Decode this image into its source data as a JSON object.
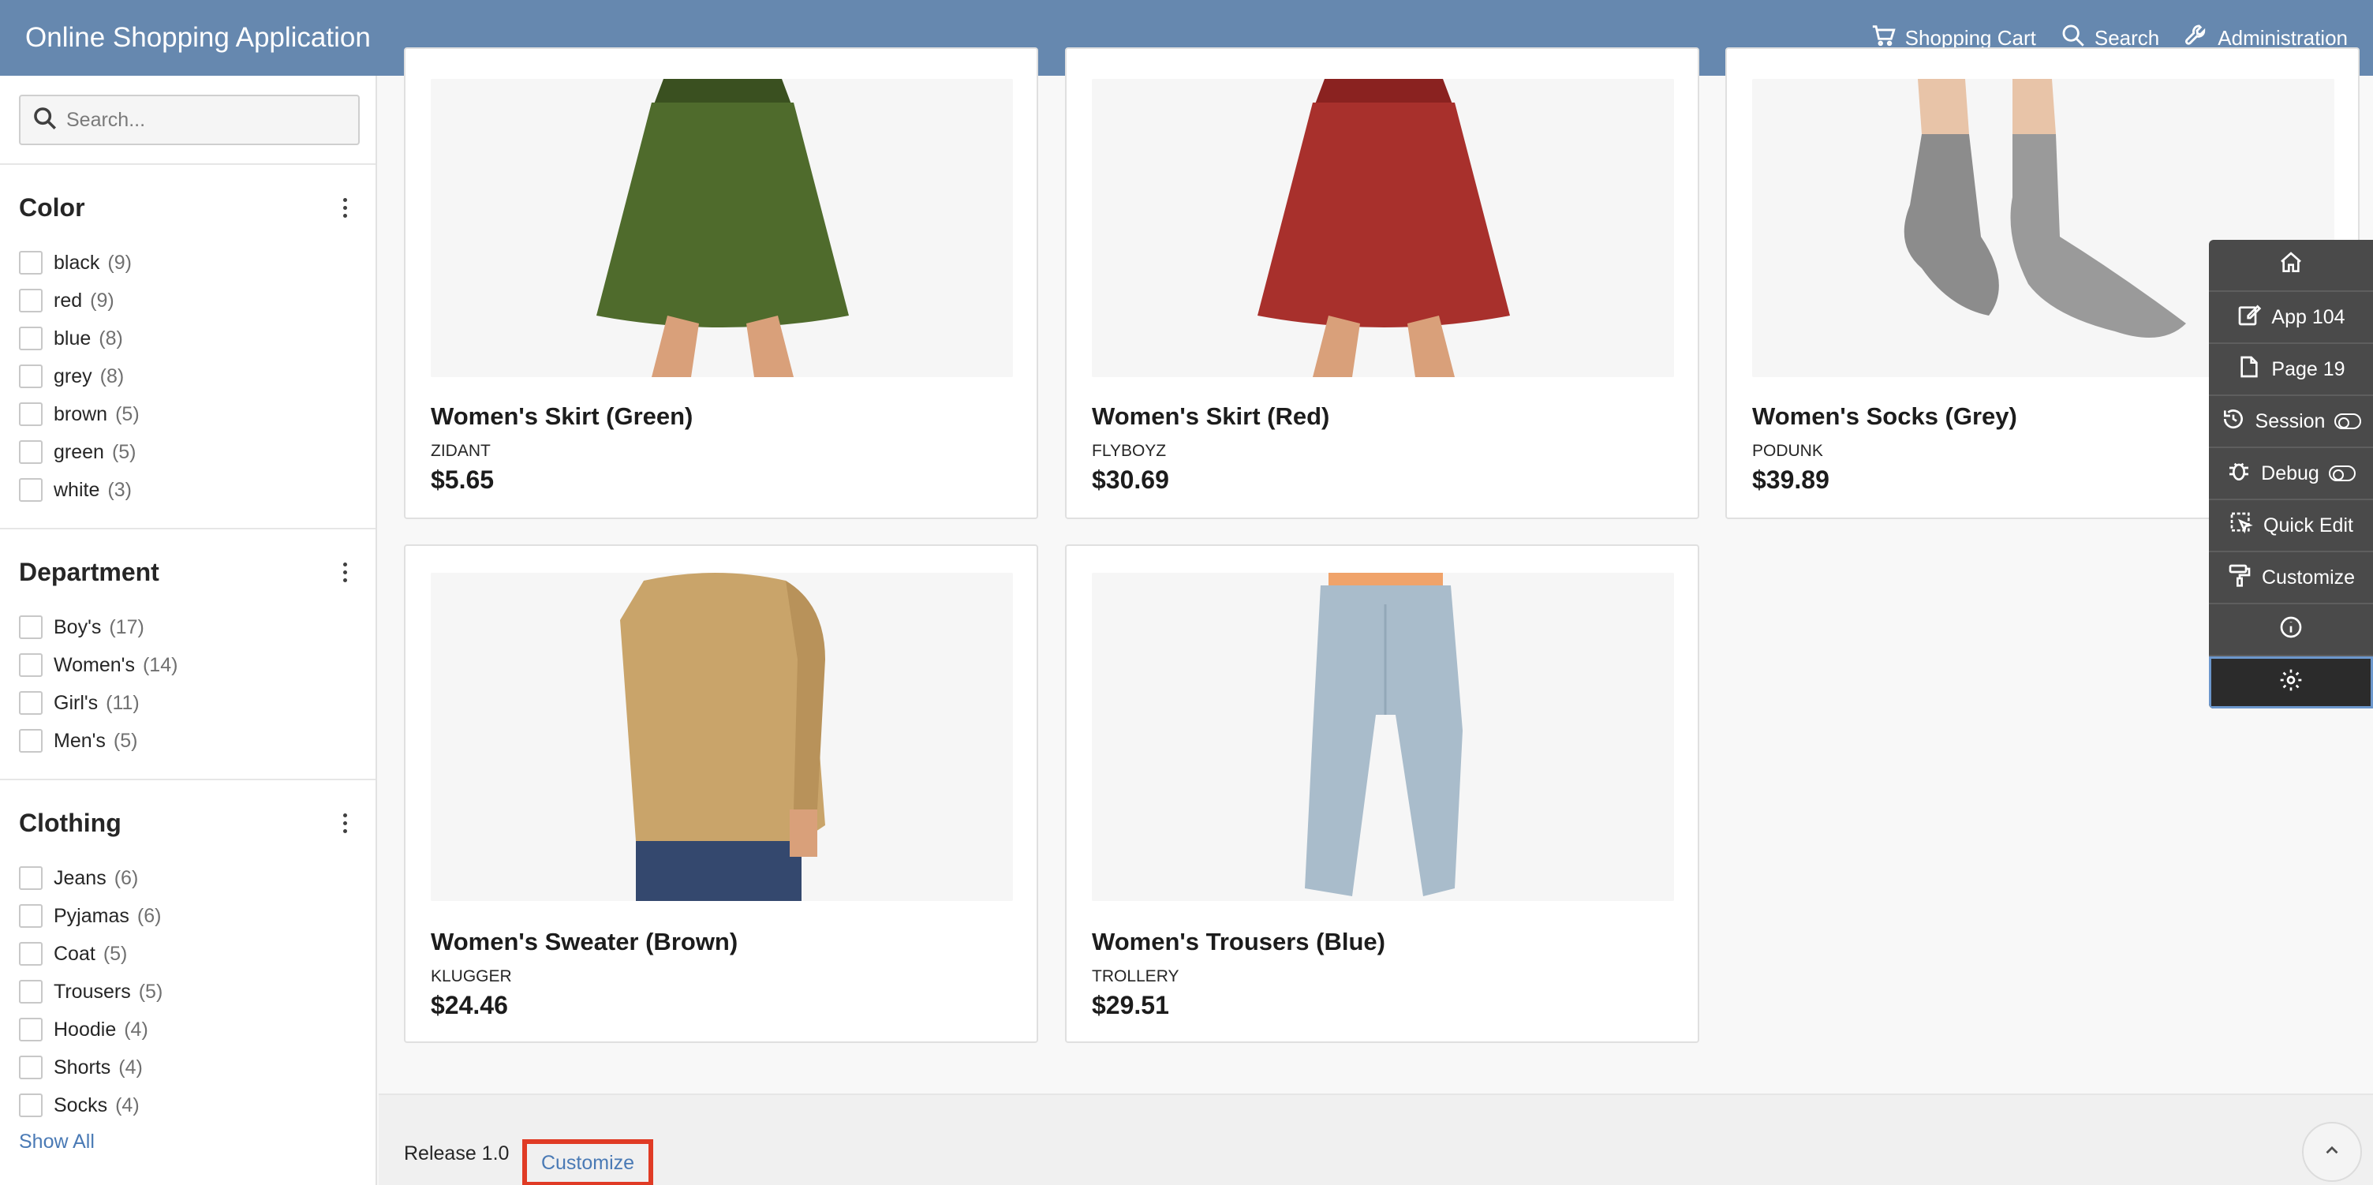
{
  "header": {
    "title": "Online Shopping Application",
    "nav": [
      {
        "label": "Shopping Cart",
        "icon": "cart-icon"
      },
      {
        "label": "Search",
        "icon": "search-icon"
      },
      {
        "label": "Administration",
        "icon": "wrench-icon"
      }
    ]
  },
  "sidebar": {
    "search": {
      "placeholder": "Search..."
    },
    "facets": [
      {
        "title": "Color",
        "items": [
          {
            "label": "black",
            "count": "(9)"
          },
          {
            "label": "red",
            "count": "(9)"
          },
          {
            "label": "blue",
            "count": "(8)"
          },
          {
            "label": "grey",
            "count": "(8)"
          },
          {
            "label": "brown",
            "count": "(5)"
          },
          {
            "label": "green",
            "count": "(5)"
          },
          {
            "label": "white",
            "count": "(3)"
          }
        ]
      },
      {
        "title": "Department",
        "items": [
          {
            "label": "Boy's",
            "count": "(17)"
          },
          {
            "label": "Women's",
            "count": "(14)"
          },
          {
            "label": "Girl's",
            "count": "(11)"
          },
          {
            "label": "Men's",
            "count": "(5)"
          }
        ]
      },
      {
        "title": "Clothing",
        "items": [
          {
            "label": "Jeans",
            "count": "(6)"
          },
          {
            "label": "Pyjamas",
            "count": "(6)"
          },
          {
            "label": "Coat",
            "count": "(5)"
          },
          {
            "label": "Trousers",
            "count": "(5)"
          },
          {
            "label": "Hoodie",
            "count": "(4)"
          },
          {
            "label": "Shorts",
            "count": "(4)"
          },
          {
            "label": "Socks",
            "count": "(4)"
          }
        ],
        "show_all": "Show All"
      }
    ]
  },
  "products": [
    {
      "name": "Women's Skirt (Green)",
      "brand": "ZIDANT",
      "price": "$5.65",
      "image": "green-skirt",
      "color": "#4f6b2c"
    },
    {
      "name": "Women's Skirt (Red)",
      "brand": "FLYBOYZ",
      "price": "$30.69",
      "image": "red-skirt",
      "color": "#a8302c"
    },
    {
      "name": "Women's Socks (Grey)",
      "brand": "PODUNK",
      "price": "$39.89",
      "image": "grey-socks",
      "color": "#8c8c8c"
    },
    {
      "name": "Women's Sweater (Brown)",
      "brand": "KLUGGER",
      "price": "$24.46",
      "image": "brown-sweater",
      "color": "#c9a46a"
    },
    {
      "name": "Women's Trousers (Blue)",
      "brand": "TROLLERY",
      "price": "$29.51",
      "image": "blue-trousers",
      "color": "#a9bccb"
    }
  ],
  "footer": {
    "release": "Release 1.0",
    "customize": "Customize"
  },
  "devbar": {
    "items": [
      {
        "label": "",
        "icon": "home-icon"
      },
      {
        "label": "App 104",
        "icon": "edit-icon"
      },
      {
        "label": "Page 19",
        "icon": "page-icon"
      },
      {
        "label": "Session",
        "icon": "history-icon",
        "toggle": true
      },
      {
        "label": "Debug",
        "icon": "bug-icon",
        "toggle": true
      },
      {
        "label": "Quick Edit",
        "icon": "quick-edit-icon"
      },
      {
        "label": "Customize",
        "icon": "paint-roller-icon"
      },
      {
        "label": "",
        "icon": "info-icon"
      },
      {
        "label": "",
        "icon": "gear-icon"
      }
    ]
  }
}
